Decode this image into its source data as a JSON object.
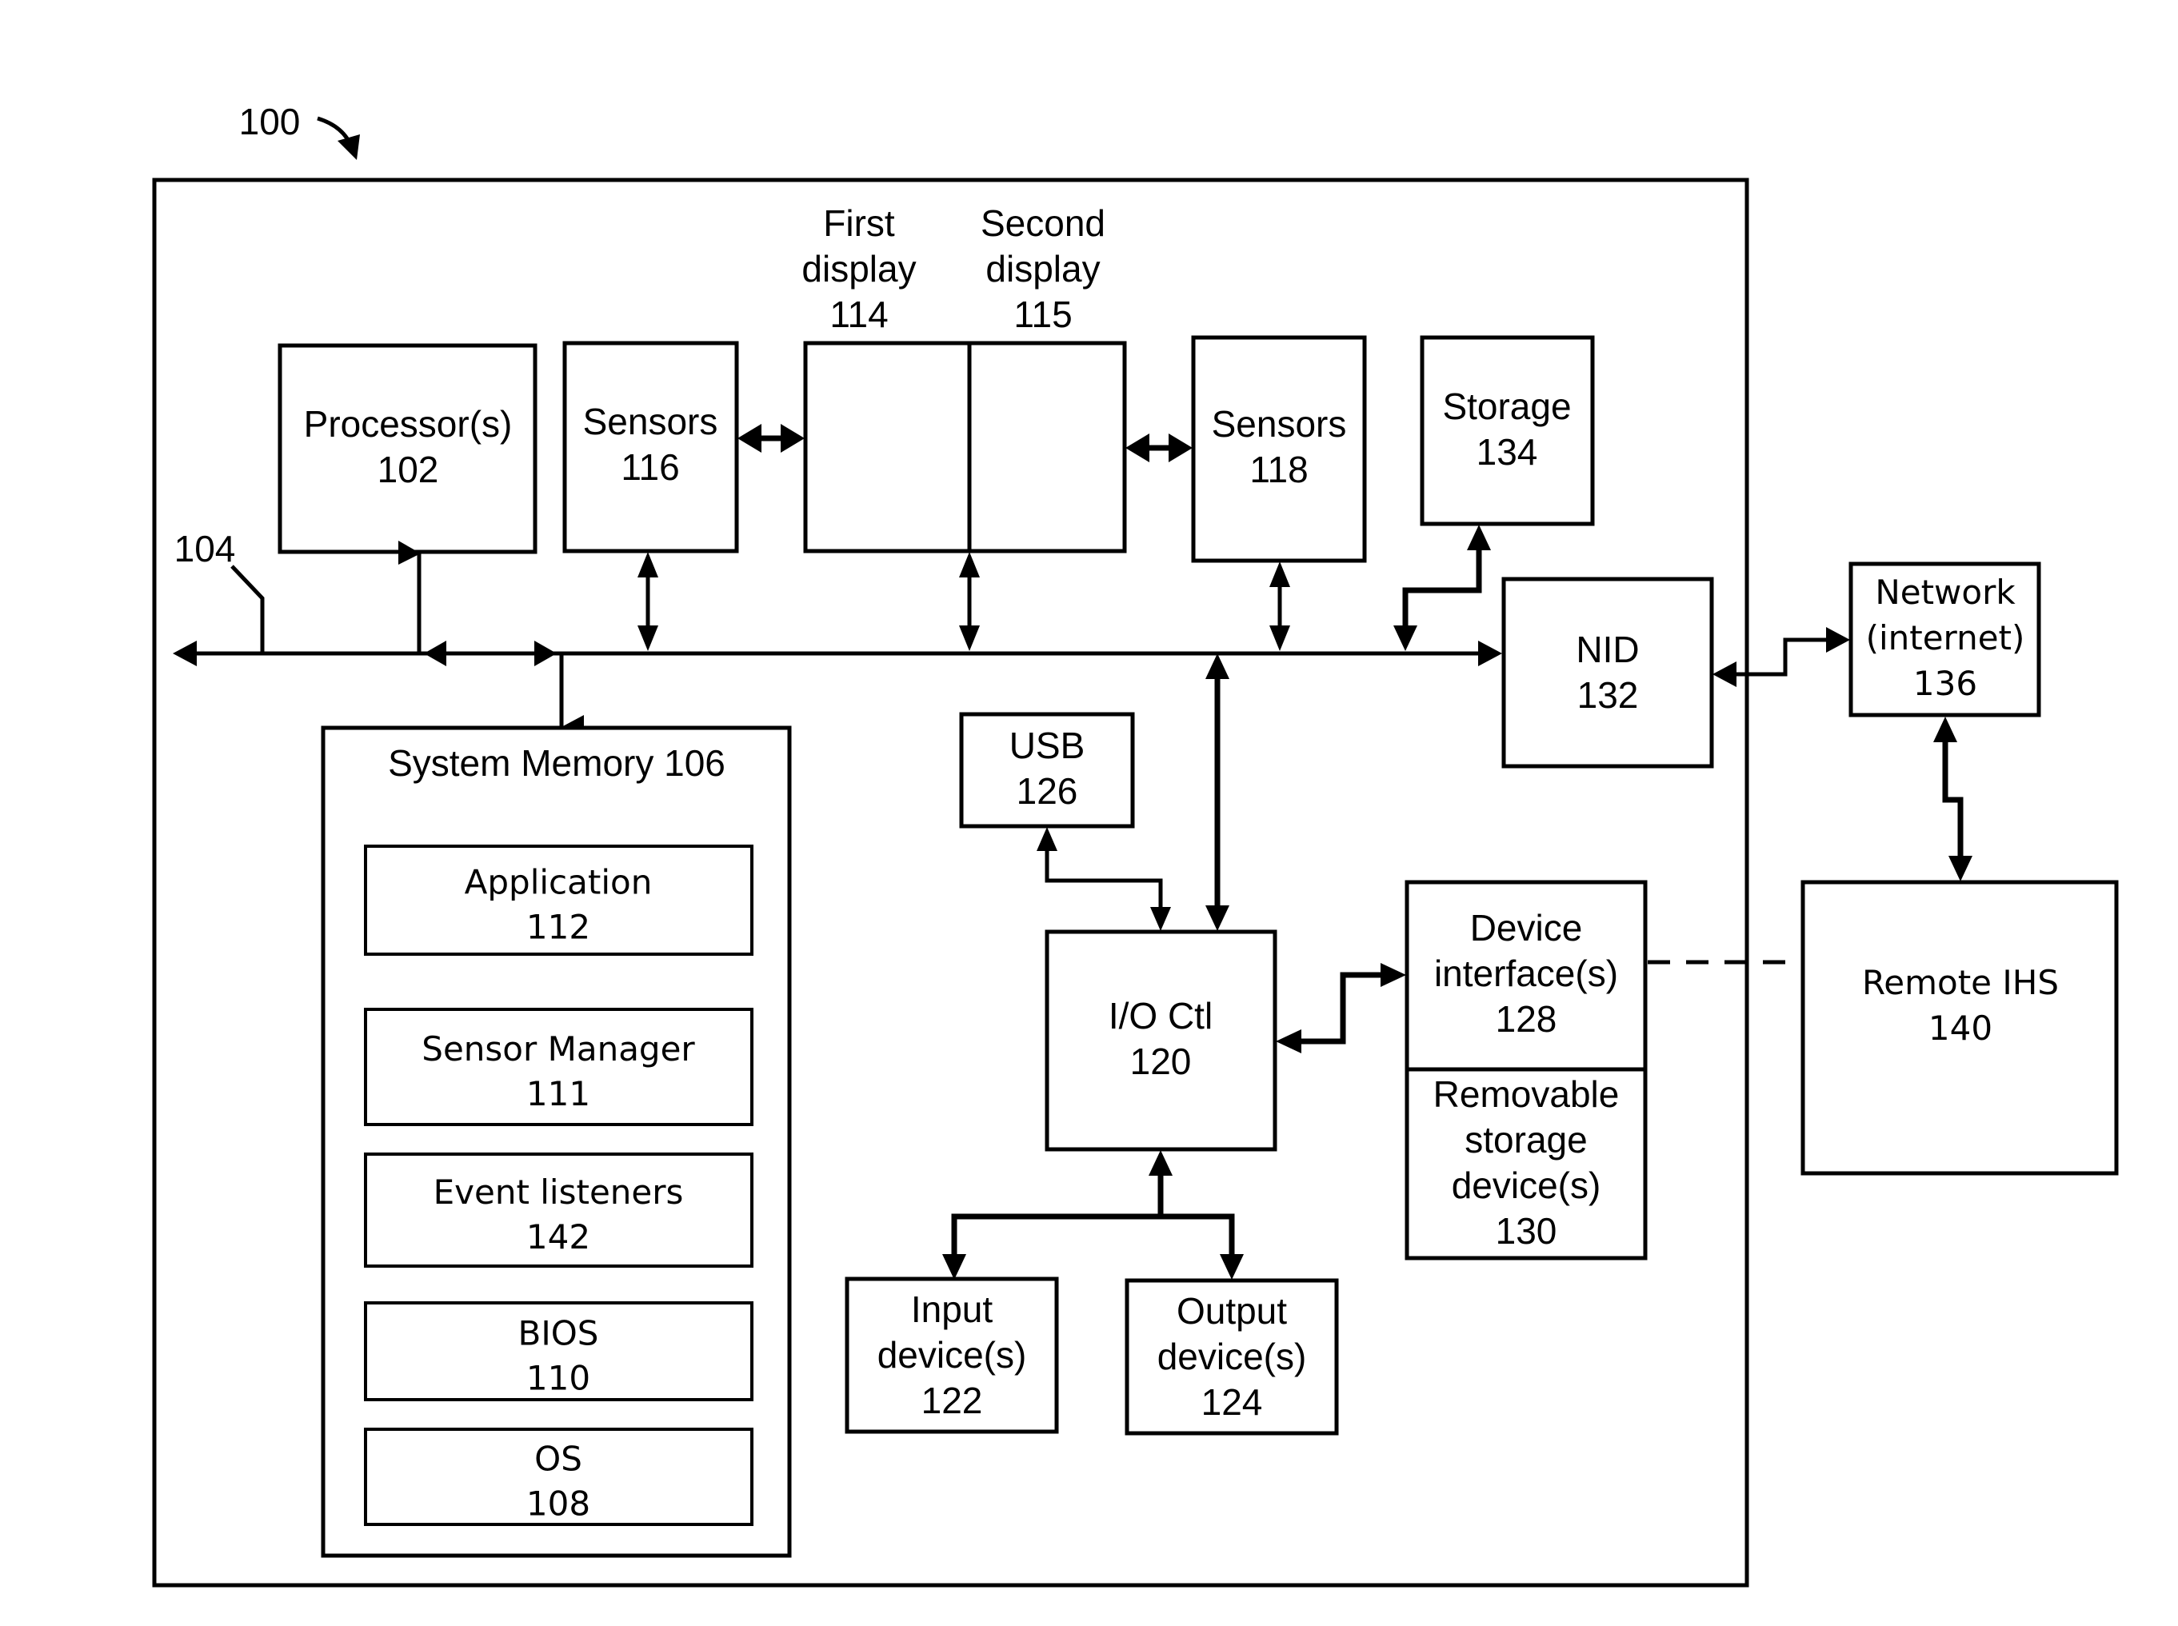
{
  "figure": {
    "reference_label": "100",
    "bus_label": "104"
  },
  "blocks": {
    "processor": {
      "name": "Processor(s)",
      "ref": "102"
    },
    "sensors_116": {
      "name": "Sensors",
      "ref": "116"
    },
    "first_display": {
      "line1": "First",
      "line2": "display",
      "ref": "114"
    },
    "second_display": {
      "line1": "Second",
      "line2": "display",
      "ref": "115"
    },
    "sensors_118": {
      "name": "Sensors",
      "ref": "118"
    },
    "storage": {
      "name": "Storage",
      "ref": "134"
    },
    "nid": {
      "name": "NID",
      "ref": "132"
    },
    "network": {
      "line1": "Network",
      "line2": "(internet)",
      "ref": "136"
    },
    "remote_ihs": {
      "name": "Remote IHS",
      "ref": "140"
    },
    "system_memory": {
      "title": "System Memory 106"
    },
    "usb": {
      "name": "USB",
      "ref": "126"
    },
    "io_ctl": {
      "name": "I/O Ctl",
      "ref": "120"
    },
    "device_interface": {
      "line1": "Device",
      "line2": "interface(s)",
      "ref": "128"
    },
    "removable_storage": {
      "line1": "Removable",
      "line2": "storage",
      "line3": "device(s)",
      "ref": "130"
    },
    "input_devices": {
      "line1": "Input",
      "line2": "device(s)",
      "ref": "122"
    },
    "output_devices": {
      "line1": "Output",
      "line2": "device(s)",
      "ref": "124"
    }
  },
  "memory_items": [
    {
      "name": "Application",
      "ref": "112"
    },
    {
      "name": "Sensor Manager",
      "ref": "111"
    },
    {
      "name": "Event listeners",
      "ref": "142"
    },
    {
      "name": "BIOS",
      "ref": "110"
    },
    {
      "name": "OS",
      "ref": "108"
    }
  ]
}
